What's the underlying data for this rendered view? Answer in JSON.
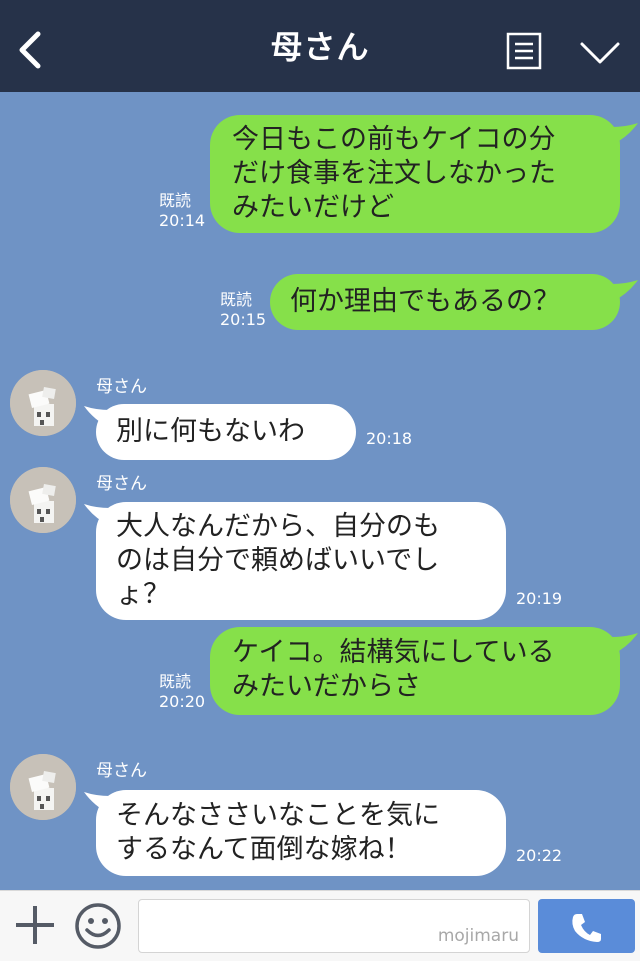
{
  "header": {
    "title": "母さん",
    "back_icon": "chevron-left-icon",
    "menu_icon": "document-list-icon",
    "expand_icon": "chevron-down-icon"
  },
  "messages": [
    {
      "side": "me",
      "lines": [
        "今日もこの前もケイコの分",
        "だけ食事を注文しなかった",
        "みたいだけど"
      ],
      "status": "既読",
      "time": "20:14"
    },
    {
      "side": "me",
      "lines": [
        "何か理由でもあるの？"
      ],
      "status": "既読",
      "time": "20:15"
    },
    {
      "side": "them",
      "sender": "母さん",
      "lines": [
        "別に何もないわ"
      ],
      "time": "20:18"
    },
    {
      "side": "them",
      "sender": "母さん",
      "lines": [
        "大人なんだから、自分のも",
        "のは自分で頼めばいいでし",
        "ょ？"
      ],
      "time": "20:19"
    },
    {
      "side": "me",
      "lines": [
        "ケイコ。結構気にしている",
        "みたいだからさ"
      ],
      "status": "既読",
      "time": "20:20"
    },
    {
      "side": "them",
      "sender": "母さん",
      "lines": [
        "そんなささいなことを気に",
        "するなんて面倒な嫁ね！"
      ],
      "time": "20:22"
    }
  ],
  "footer": {
    "plus_icon": "plus-icon",
    "emoji_icon": "smiley-icon",
    "input_value": "",
    "watermark": "mojimaru",
    "call_icon": "phone-icon"
  },
  "colors": {
    "header_bg": "#263249",
    "chat_bg": "#6f93c5",
    "my_bubble": "#86e04a",
    "their_bubble": "#ffffff",
    "call_button": "#5a8cd9"
  }
}
